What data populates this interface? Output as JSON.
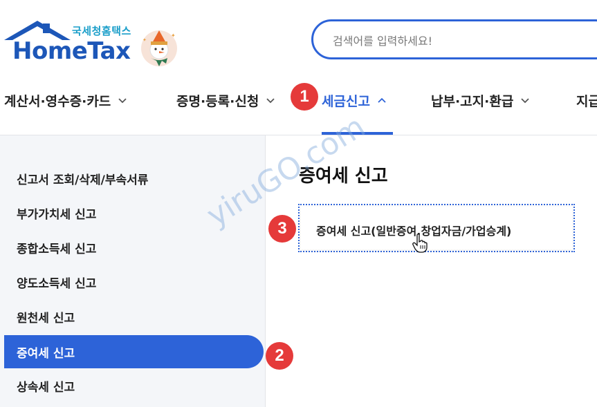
{
  "logo": {
    "sub_text": "국세청홈택스",
    "main_text": "HomeTax"
  },
  "search": {
    "placeholder": "검색어를 입력하세요!"
  },
  "nav": {
    "items": [
      {
        "label": "계산서·영수증·카드"
      },
      {
        "label": "증명·등록·신청"
      },
      {
        "label": "세금신고"
      },
      {
        "label": "납부·고지·환급"
      },
      {
        "label": "지급"
      }
    ],
    "active_index": 2
  },
  "sidebar": {
    "items": [
      {
        "label": "신고서 조회/삭제/부속서류"
      },
      {
        "label": "부가가치세 신고"
      },
      {
        "label": "종합소득세 신고"
      },
      {
        "label": "양도소득세 신고"
      },
      {
        "label": "원천세 신고"
      },
      {
        "label": "증여세 신고"
      },
      {
        "label": "상속세 신고"
      }
    ],
    "active_index": 5
  },
  "main": {
    "title": "증여세 신고",
    "result_link": "증여세 신고(일반증여,창업자금/가업승계)"
  },
  "badges": {
    "step1": "1",
    "step2": "2",
    "step3": "3"
  },
  "watermark": "yiruGO.com",
  "colors": {
    "accent": "#2d63d8",
    "badge": "#e53a3a",
    "sidebar_bg": "#f4f6f9"
  }
}
